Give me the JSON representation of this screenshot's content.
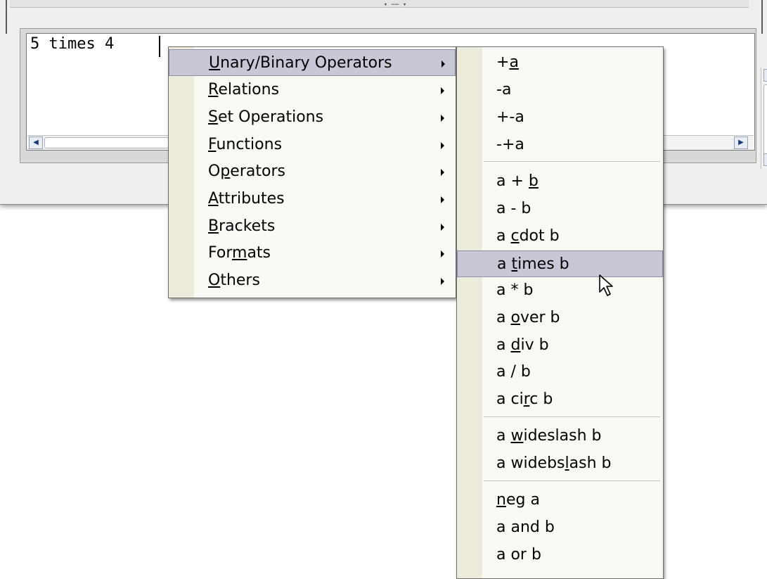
{
  "editor": {
    "text": "5 times 4"
  },
  "top_grip": "▾ ⋯⋯ ▾",
  "context_menu": {
    "items": [
      {
        "pre": "",
        "u": "U",
        "post": "nary/Binary Operators"
      },
      {
        "pre": "",
        "u": "R",
        "post": "elations"
      },
      {
        "pre": "",
        "u": "S",
        "post": "et Operations"
      },
      {
        "pre": "",
        "u": "F",
        "post": "unctions"
      },
      {
        "pre": "O",
        "u": "p",
        "post": "erators"
      },
      {
        "pre": "",
        "u": "A",
        "post": "ttributes"
      },
      {
        "pre": "",
        "u": "B",
        "post": "rackets"
      },
      {
        "pre": "For",
        "u": "m",
        "post": "ats"
      },
      {
        "pre": "",
        "u": "O",
        "post": "thers"
      }
    ]
  },
  "submenu": {
    "items": [
      {
        "pre": "+",
        "u": "a",
        "post": ""
      },
      {
        "pre": "-a",
        "u": "",
        "post": ""
      },
      {
        "pre": "+-a",
        "u": "",
        "post": ""
      },
      {
        "pre": "-+a",
        "u": "",
        "post": ""
      },
      {
        "pre": "a + ",
        "u": "b",
        "post": ""
      },
      {
        "pre": "a - b",
        "u": "",
        "post": ""
      },
      {
        "pre": "a ",
        "u": "c",
        "post": "dot b"
      },
      {
        "pre": "a ",
        "u": "t",
        "post": "imes b"
      },
      {
        "pre": "a * b",
        "u": "",
        "post": ""
      },
      {
        "pre": "a ",
        "u": "o",
        "post": "ver b"
      },
      {
        "pre": "a ",
        "u": "d",
        "post": "iv b"
      },
      {
        "pre": "a / b",
        "u": "",
        "post": ""
      },
      {
        "pre": "a ci",
        "u": "r",
        "post": "c b"
      },
      {
        "pre": "a ",
        "u": "w",
        "post": "ideslash b"
      },
      {
        "pre": "a widebs",
        "u": "l",
        "post": "ash b"
      },
      {
        "pre": "",
        "u": "n",
        "post": "eg a"
      },
      {
        "pre": "a and b",
        "u": "",
        "post": ""
      },
      {
        "pre": "a or b",
        "u": "",
        "post": ""
      }
    ]
  }
}
